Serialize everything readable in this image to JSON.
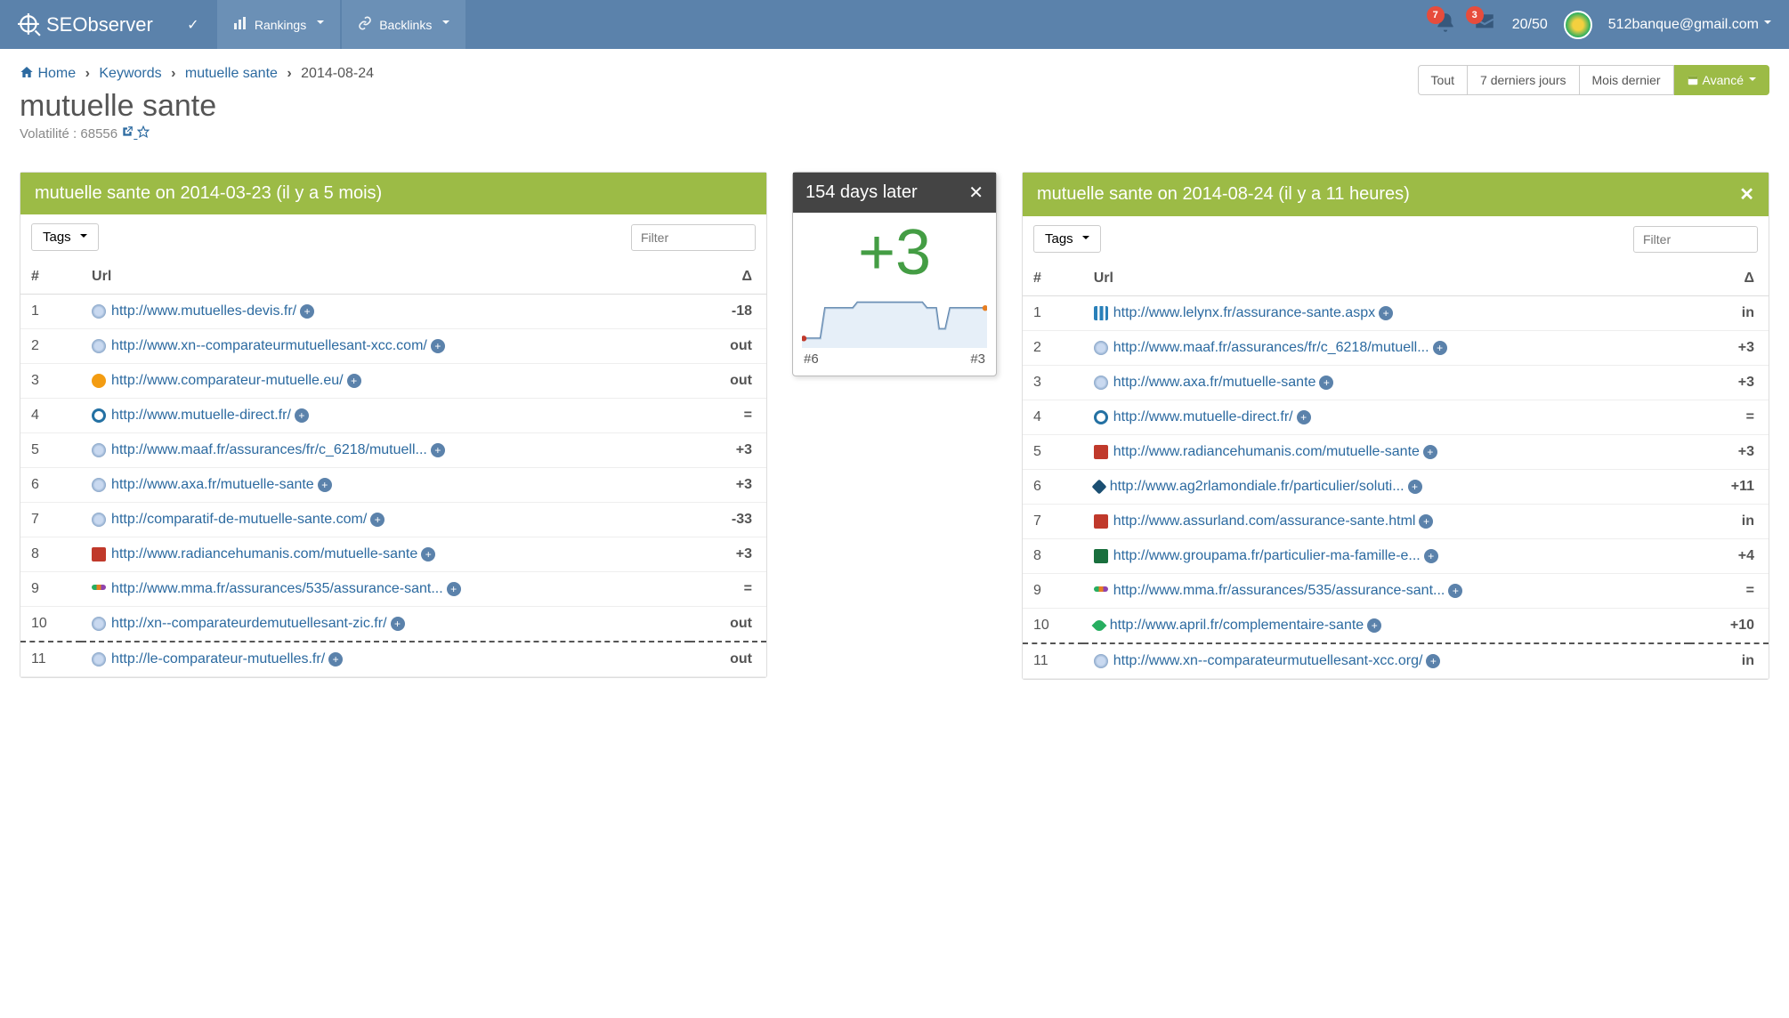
{
  "brand": "SEObserver",
  "nav": {
    "rankings": "Rankings",
    "backlinks": "Backlinks"
  },
  "notifications": {
    "bell": "7",
    "inbox": "3"
  },
  "quota": "20/50",
  "user_email": "512banque@gmail.com",
  "breadcrumb": {
    "home": "Home",
    "keywords": "Keywords",
    "kw": "mutuelle sante",
    "date": "2014-08-24"
  },
  "range_buttons": {
    "all": "Tout",
    "seven": "7 derniers jours",
    "month": "Mois dernier",
    "advanced": "Avancé"
  },
  "title": "mutuelle sante",
  "volatility_label": "Volatilité :",
  "volatility_value": "68556",
  "left_panel_title": "mutuelle sante on 2014-03-23 (il y a 5 mois)",
  "right_panel_title": "mutuelle sante on 2014-08-24 (il y a 11 heures)",
  "tags_label": "Tags",
  "filter_placeholder": "Filter",
  "columns": {
    "rank": "#",
    "url": "Url",
    "delta": "Δ"
  },
  "mid": {
    "title": "154 days later",
    "delta": "+3",
    "from": "#6",
    "to": "#3"
  },
  "chart_data": {
    "type": "line",
    "x": [
      0,
      1,
      2,
      3,
      4,
      5,
      6,
      7,
      8,
      9,
      10,
      11
    ],
    "values_rank": [
      6,
      6,
      3,
      3,
      3,
      3,
      3,
      3,
      3,
      5,
      3,
      3
    ],
    "ylim_rank": [
      7,
      2
    ],
    "start_label": "#6",
    "end_label": "#3"
  },
  "left_rows": [
    {
      "rank": "1",
      "url": "http://www.mutuelles-devis.fr/",
      "icon": "globe",
      "delta": "-18",
      "cls": "neg"
    },
    {
      "rank": "2",
      "url": "http://www.xn--comparateurmutuellesant-xcc.com/",
      "icon": "globe",
      "delta": "out",
      "cls": "neg"
    },
    {
      "rank": "3",
      "url": "http://www.comparateur-mutuelle.eu/",
      "icon": "yel",
      "delta": "out",
      "cls": "neg"
    },
    {
      "rank": "4",
      "url": "http://www.mutuelle-direct.fr/",
      "icon": "blue2",
      "delta": "=",
      "cls": "eq"
    },
    {
      "rank": "5",
      "url": "http://www.maaf.fr/assurances/fr/c_6218/mutuell...",
      "icon": "globe",
      "delta": "+3",
      "cls": "pos"
    },
    {
      "rank": "6",
      "url": "http://www.axa.fr/mutuelle-sante",
      "icon": "globe",
      "delta": "+3",
      "cls": "pos"
    },
    {
      "rank": "7",
      "url": "http://comparatif-de-mutuelle-sante.com/",
      "icon": "globe",
      "delta": "-33",
      "cls": "neg"
    },
    {
      "rank": "8",
      "url": "http://www.radiancehumanis.com/mutuelle-sante",
      "icon": "red",
      "delta": "+3",
      "cls": "pos"
    },
    {
      "rank": "9",
      "url": "http://www.mma.fr/assurances/535/assurance-sant...",
      "icon": "dots",
      "delta": "=",
      "cls": "eq"
    },
    {
      "rank": "10",
      "url": "http://xn--comparateurdemutuellesant-zic.fr/",
      "icon": "globe",
      "delta": "out",
      "cls": "neg",
      "dash": true
    },
    {
      "rank": "11",
      "url": "http://le-comparateur-mutuelles.fr/",
      "icon": "globe",
      "delta": "out",
      "cls": "neg"
    }
  ],
  "right_rows": [
    {
      "rank": "1",
      "url": "http://www.lelynx.fr/assurance-sante.aspx",
      "icon": "bars",
      "delta": "in",
      "cls": "pos"
    },
    {
      "rank": "2",
      "url": "http://www.maaf.fr/assurances/fr/c_6218/mutuell...",
      "icon": "globe",
      "delta": "+3",
      "cls": "pos"
    },
    {
      "rank": "3",
      "url": "http://www.axa.fr/mutuelle-sante",
      "icon": "globe",
      "delta": "+3",
      "cls": "pos"
    },
    {
      "rank": "4",
      "url": "http://www.mutuelle-direct.fr/",
      "icon": "blue2",
      "delta": "=",
      "cls": "eq"
    },
    {
      "rank": "5",
      "url": "http://www.radiancehumanis.com/mutuelle-sante",
      "icon": "red",
      "delta": "+3",
      "cls": "pos"
    },
    {
      "rank": "6",
      "url": "http://www.ag2rlamondiale.fr/particulier/soluti...",
      "icon": "diamond",
      "delta": "+11",
      "cls": "pos"
    },
    {
      "rank": "7",
      "url": "http://www.assurland.com/assurance-sante.html",
      "icon": "ared",
      "delta": "in",
      "cls": "pos"
    },
    {
      "rank": "8",
      "url": "http://www.groupama.fr/particulier-ma-famille-e...",
      "icon": "grn",
      "delta": "+4",
      "cls": "pos"
    },
    {
      "rank": "9",
      "url": "http://www.mma.fr/assurances/535/assurance-sant...",
      "icon": "dots",
      "delta": "=",
      "cls": "eq"
    },
    {
      "rank": "10",
      "url": "http://www.april.fr/complementaire-sante",
      "icon": "leaf",
      "delta": "+10",
      "cls": "pos",
      "dash": true
    },
    {
      "rank": "11",
      "url": "http://www.xn--comparateurmutuellesant-xcc.org/",
      "icon": "globe",
      "delta": "in",
      "cls": "pos"
    }
  ]
}
